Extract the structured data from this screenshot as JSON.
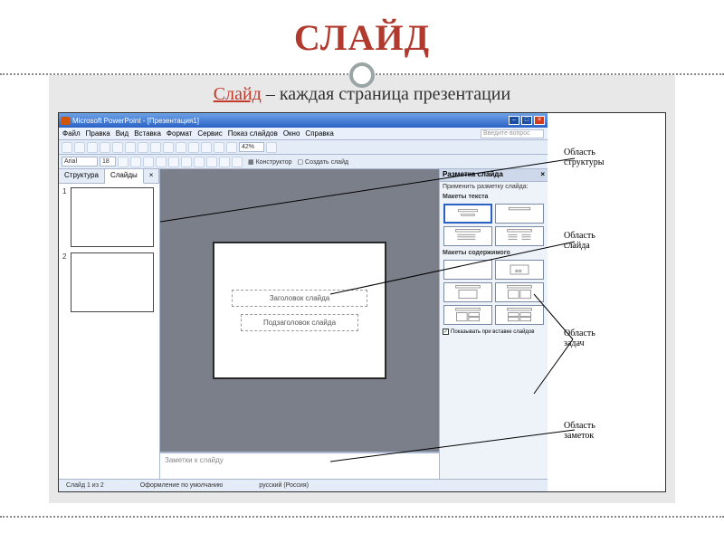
{
  "page": {
    "title": "СЛАЙД",
    "definition_term": "Слайд",
    "definition_rest": " – каждая страница презентации"
  },
  "app": {
    "titlebar": "Microsoft PowerPoint - [Презентация1]",
    "menu": [
      "Файл",
      "Правка",
      "Вид",
      "Вставка",
      "Формат",
      "Сервис",
      "Показ слайдов",
      "Окно",
      "Справка"
    ],
    "question_placeholder": "Введите вопрос",
    "zoom": "42%",
    "font": "Arial",
    "fontsize": "18",
    "toolbar2_labels": {
      "konstructor": "Конструктор",
      "create": "Создать слайд"
    },
    "outline": {
      "tab_struct": "Структура",
      "tab_slides": "Слайды",
      "thumb_numbers": [
        "1",
        "2"
      ]
    },
    "slide": {
      "title_ph": "Заголовок слайда",
      "subtitle_ph": "Подзаголовок слайда"
    },
    "notes_ph": "Заметки к слайду",
    "taskpane": {
      "header": "Разметка слайда",
      "apply": "Применить разметку слайда:",
      "sec_text": "Макеты текста",
      "sec_content": "Макеты содержимого",
      "show_check": "Показывать при вставке слайдов"
    },
    "status": {
      "slide_of": "Слайд 1 из 2",
      "design": "Оформление по умолчанию",
      "lang": "русский (Россия)"
    }
  },
  "annotations": {
    "structure": "Область\nструктуры",
    "slide": "Область\nслайда",
    "tasks": "Область\nзадач",
    "notes": "Область\nзаметок"
  }
}
